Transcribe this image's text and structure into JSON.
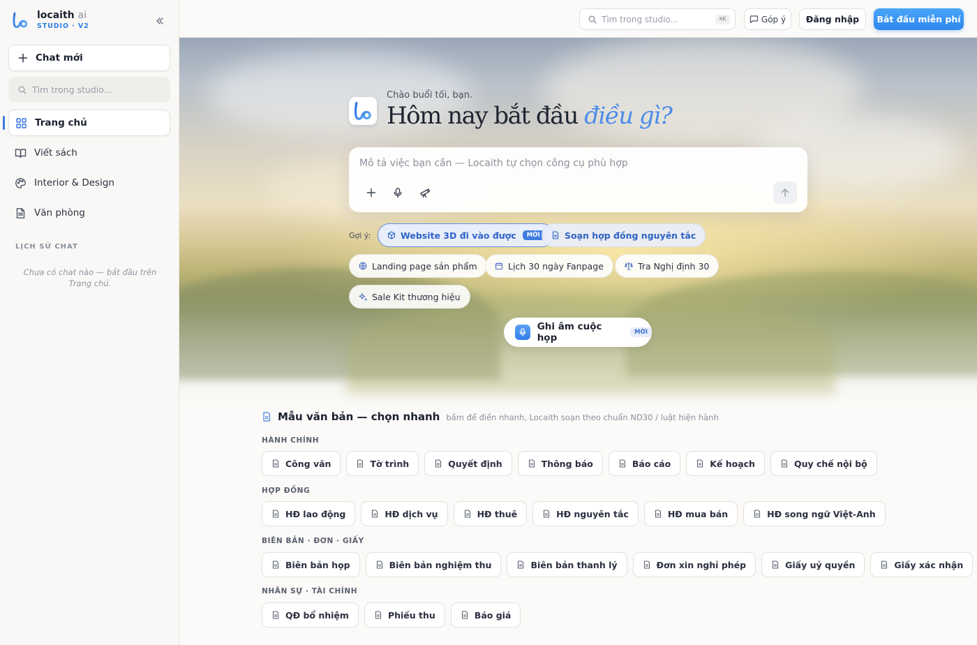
{
  "brand": {
    "name": "locaith",
    "name_suffix": "ai",
    "subtitle": "STUDIO · V2",
    "accent_color": "#2f7de8"
  },
  "sidebar": {
    "new_chat_label": "Chat mới",
    "search_placeholder": "Tìm trong studio...",
    "items": [
      {
        "label": "Trang chủ",
        "icon": "grid-icon",
        "active": true
      },
      {
        "label": "Viết sách",
        "icon": "book-icon"
      },
      {
        "label": "Interior & Design",
        "icon": "palette-icon"
      },
      {
        "label": "Văn phòng",
        "icon": "document-icon"
      }
    ],
    "history_title": "LỊCH SỬ CHAT",
    "history_empty": "Chưa có chat nào — bắt đầu trên Trang chủ."
  },
  "topbar": {
    "search_placeholder": "Tìm trong studio...",
    "search_shortcut": "⌘K",
    "feedback_label": "Góp ý",
    "login_label": "Đăng nhập",
    "start_label": "Bắt đầu miễn phí"
  },
  "hero": {
    "greeting": "Chào buổi tối, bạn.",
    "headline_main": "Hôm nay bắt đầu",
    "headline_accent": "điều gì?",
    "prompt_placeholder": "Mô tả việc bạn cần — Locaith tự chọn công cụ phù hợp",
    "suggest_label": "Gợi ý:",
    "suggestions": [
      {
        "label": "Website 3D đi vào được",
        "badge": "MỚI",
        "icon": "cube-icon"
      },
      {
        "label": "Soạn hợp đồng nguyên tắc",
        "icon": "document-icon"
      },
      {
        "label": "Landing page sản phẩm",
        "icon": "globe-icon"
      },
      {
        "label": "Lịch 30 ngày Fanpage",
        "icon": "calendar-icon"
      },
      {
        "label": "Tra Nghị định 30",
        "icon": "scale-icon"
      },
      {
        "label": "Sale Kit thương hiệu",
        "icon": "sparkle-icon"
      }
    ],
    "record_label": "Ghi âm cuộc họp",
    "record_badge": "MỚI"
  },
  "templates": {
    "title": "Mẫu văn bản — chọn nhanh",
    "subtitle": "bấm để điền nhanh, Locaith soạn theo chuẩn ND30 / luật hiện hành",
    "groups": [
      {
        "label": "HÀNH CHÍNH",
        "items": [
          "Công văn",
          "Tờ trình",
          "Quyết định",
          "Thông báo",
          "Báo cáo",
          "Kế hoạch",
          "Quy chế nội bộ"
        ]
      },
      {
        "label": "HỢP ĐỒNG",
        "items": [
          "HĐ lao động",
          "HĐ dịch vụ",
          "HĐ thuê",
          "HĐ nguyên tắc",
          "HĐ mua bán",
          "HĐ song ngữ Việt-Anh"
        ]
      },
      {
        "label": "BIÊN BẢN · ĐƠN · GIẤY",
        "items": [
          "Biên bản họp",
          "Biên bản nghiệm thu",
          "Biên bản thanh lý",
          "Đơn xin nghỉ phép",
          "Giấy uỷ quyền",
          "Giấy xác nhận"
        ]
      },
      {
        "label": "NHÂN SỰ · TÀI CHÍNH",
        "items": [
          "QĐ bổ nhiệm",
          "Phiếu thu",
          "Báo giá"
        ]
      }
    ]
  }
}
